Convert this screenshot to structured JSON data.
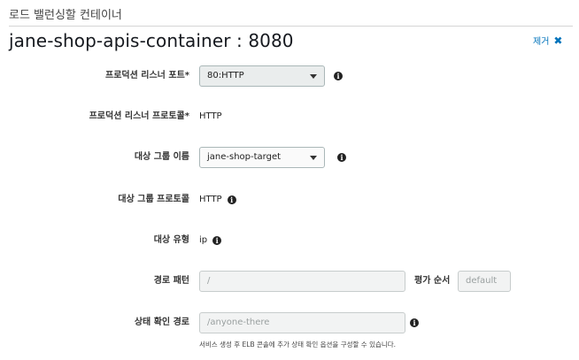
{
  "section": {
    "title": "로드 밸런싱할 컨테이너"
  },
  "container": {
    "title": "jane-shop-apis-container : 8080",
    "remove_label": "제거"
  },
  "fields": {
    "production_listener_port": {
      "label": "프로덕션 리스너 포트*",
      "value": "80:HTTP"
    },
    "production_listener_protocol": {
      "label": "프로덕션 리스너 프로토콜*",
      "value": "HTTP"
    },
    "target_group_name": {
      "label": "대상 그룹 이름",
      "value": "jane-shop-target"
    },
    "target_group_protocol": {
      "label": "대상 그룹 프로토콜",
      "value": "HTTP"
    },
    "target_type": {
      "label": "대상 유형",
      "value": "ip"
    },
    "path_pattern": {
      "label": "경로 패턴",
      "placeholder": "/"
    },
    "evaluation_order": {
      "label": "평가 순서",
      "placeholder": "default"
    },
    "health_check_path": {
      "label": "상태 확인 경로",
      "placeholder": "/anyone-there",
      "hint": "서비스 생성 후 ELB 콘솔에 추가 상태 확인 옵션을 구성할 수 있습니다."
    }
  },
  "icons": {
    "info": "info-icon",
    "remove": "close-icon",
    "dropdown": "caret-down-icon"
  }
}
